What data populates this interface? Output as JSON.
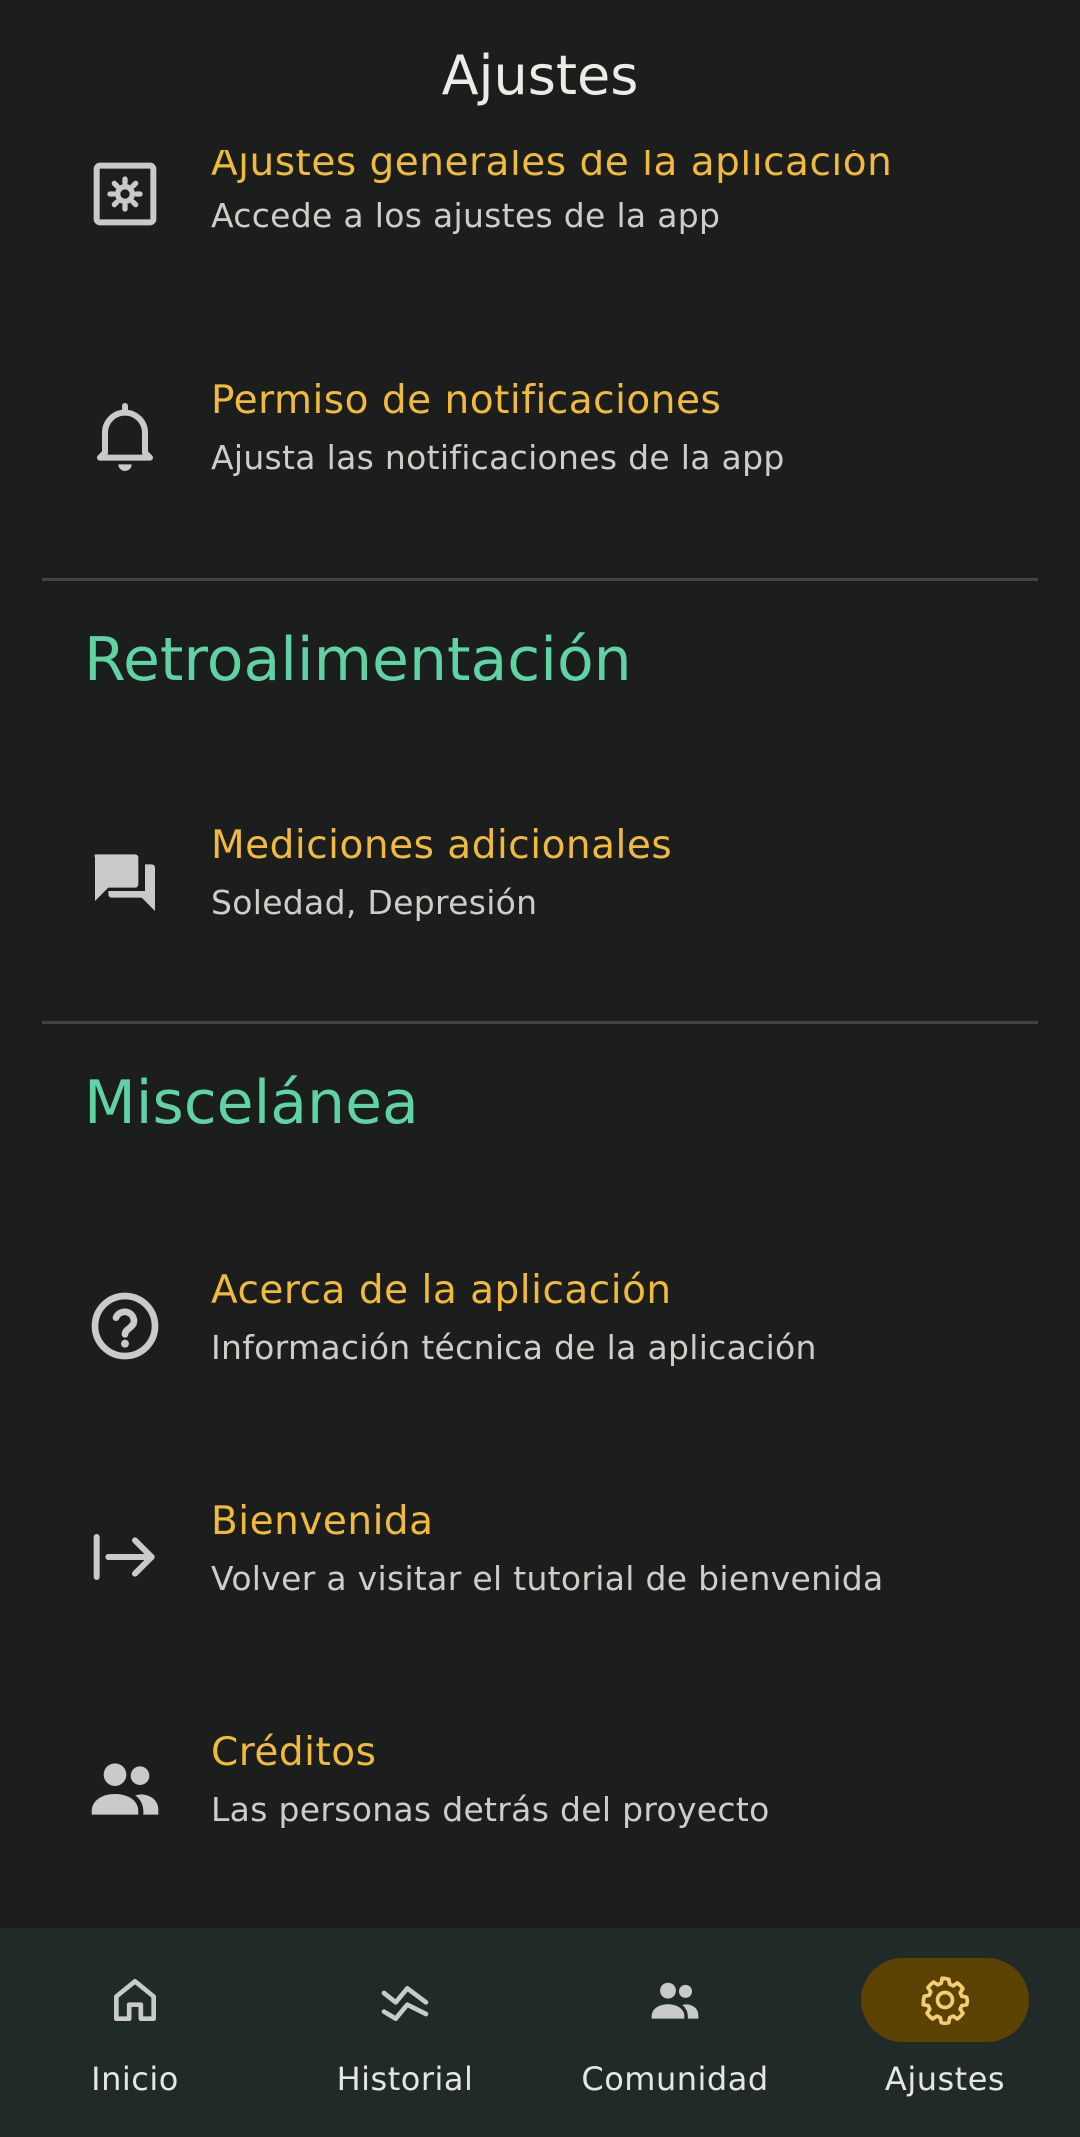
{
  "header": {
    "title": "Ajustes"
  },
  "sections": {
    "general": {
      "items": [
        {
          "title": "Ajustes generales de la aplicación",
          "subtitle": "Accede a los ajustes de la app",
          "icon": "settings-app-icon"
        },
        {
          "title": "Permiso de notificaciones",
          "subtitle": "Ajusta las notificaciones de la app",
          "icon": "bell-icon"
        }
      ]
    },
    "feedback": {
      "heading": "Retroalimentación",
      "items": [
        {
          "title": "Mediciones adicionales",
          "subtitle": "Soledad, Depresión",
          "icon": "forum-icon"
        }
      ]
    },
    "misc": {
      "heading": "Miscelánea",
      "items": [
        {
          "title": "Acerca de la aplicación",
          "subtitle": "Información técnica de la aplicación",
          "icon": "help-circle-icon"
        },
        {
          "title": "Bienvenida",
          "subtitle": "Volver a visitar el tutorial de bienvenida",
          "icon": "arrow-right-to-bar-icon"
        },
        {
          "title": "Créditos",
          "subtitle": "Las personas detrás del proyecto",
          "icon": "people-icon"
        }
      ]
    }
  },
  "bottom_nav": {
    "items": [
      {
        "label": "Inicio",
        "icon": "home-icon",
        "active": false
      },
      {
        "label": "Historial",
        "icon": "history-chart-icon",
        "active": false
      },
      {
        "label": "Comunidad",
        "icon": "community-icon",
        "active": false
      },
      {
        "label": "Ajustes",
        "icon": "gear-icon",
        "active": true
      }
    ]
  },
  "colors": {
    "background": "#1c1d1d",
    "item_title": "#f0ba3c",
    "section_heading": "#5fd3a3",
    "nav_background": "#202a28",
    "nav_active_pill": "#5c4203"
  }
}
